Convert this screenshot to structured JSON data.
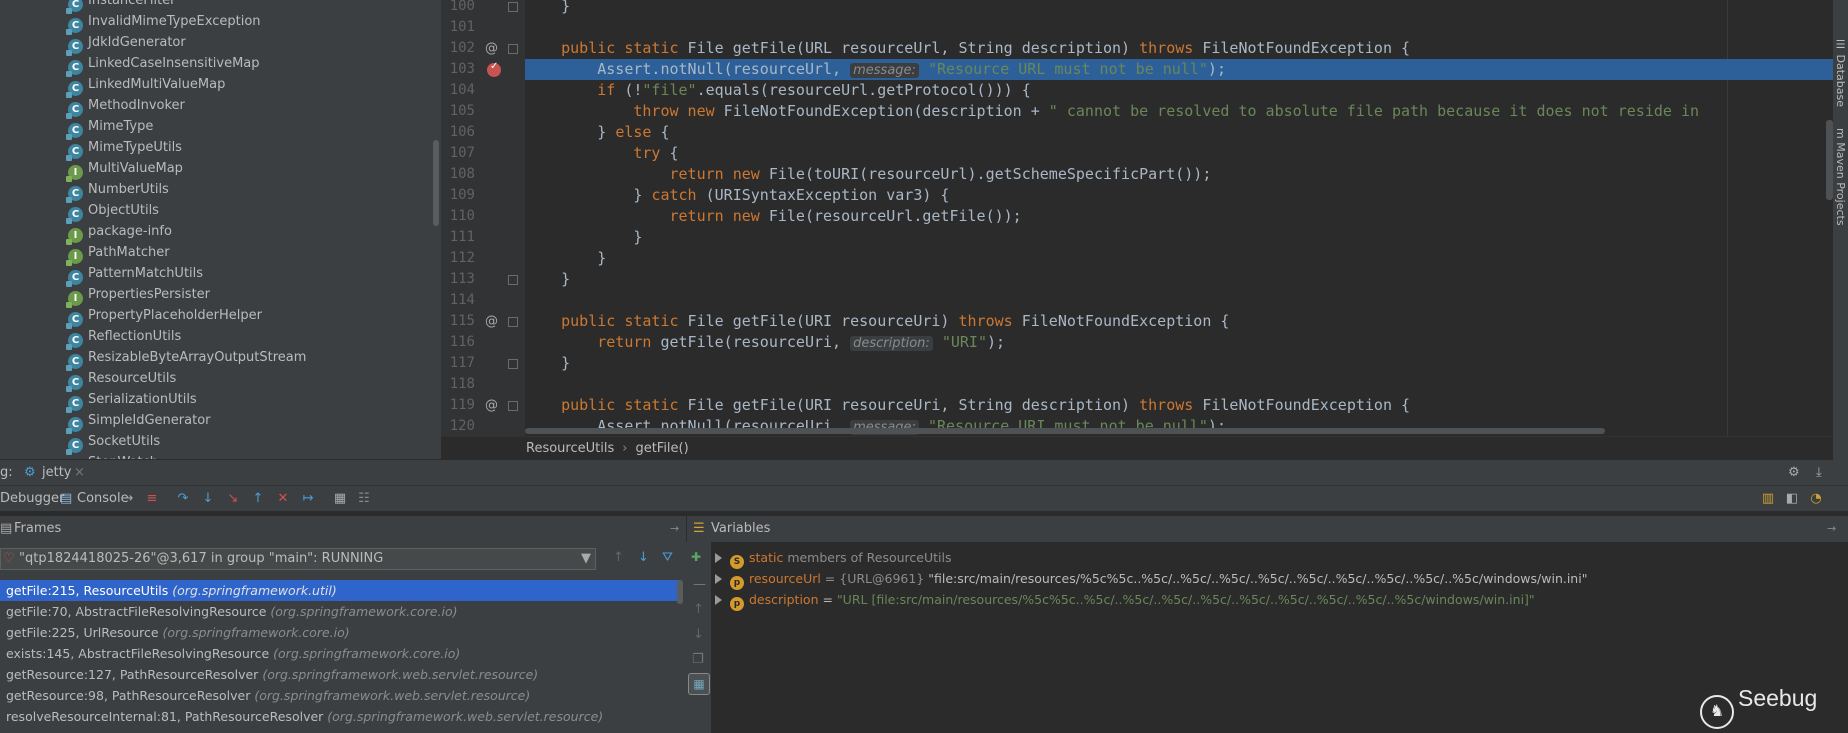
{
  "project_tree": {
    "items": [
      {
        "name": "InstanceFilter",
        "kind": "c"
      },
      {
        "name": "InvalidMimeTypeException",
        "kind": "c"
      },
      {
        "name": "JdkIdGenerator",
        "kind": "c"
      },
      {
        "name": "LinkedCaseInsensitiveMap",
        "kind": "c"
      },
      {
        "name": "LinkedMultiValueMap",
        "kind": "c"
      },
      {
        "name": "MethodInvoker",
        "kind": "c"
      },
      {
        "name": "MimeType",
        "kind": "c"
      },
      {
        "name": "MimeTypeUtils",
        "kind": "c"
      },
      {
        "name": "MultiValueMap",
        "kind": "i"
      },
      {
        "name": "NumberUtils",
        "kind": "c"
      },
      {
        "name": "ObjectUtils",
        "kind": "c"
      },
      {
        "name": "package-info",
        "kind": "i"
      },
      {
        "name": "PathMatcher",
        "kind": "i"
      },
      {
        "name": "PatternMatchUtils",
        "kind": "c"
      },
      {
        "name": "PropertiesPersister",
        "kind": "i"
      },
      {
        "name": "PropertyPlaceholderHelper",
        "kind": "c"
      },
      {
        "name": "ReflectionUtils",
        "kind": "c"
      },
      {
        "name": "ResizableByteArrayOutputStream",
        "kind": "c"
      },
      {
        "name": "ResourceUtils",
        "kind": "c"
      },
      {
        "name": "SerializationUtils",
        "kind": "c"
      },
      {
        "name": "SimpleIdGenerator",
        "kind": "c"
      },
      {
        "name": "SocketUtils",
        "kind": "c"
      },
      {
        "name": "StopWatch",
        "kind": "c"
      }
    ]
  },
  "editor": {
    "lines": [
      {
        "no": "100",
        "html": "    }"
      },
      {
        "no": "101",
        "html": ""
      },
      {
        "no": "102",
        "html": "    <span class=\"kw\">public static</span> File getFile(URL resourceUrl, String description) <span class=\"kw\">throws</span> FileNotFoundException {",
        "mark": "@"
      },
      {
        "no": "103",
        "html": "        Assert.notNull(resourceUrl, <span class=\"hint\">message:</span> <span class=\"str\">\"Resource URL must not be null\"</span>);",
        "hl": true,
        "bp": true
      },
      {
        "no": "104",
        "html": "        <span class=\"kw\">if</span> (!<span class=\"str\">\"file\"</span>.equals(resourceUrl.getProtocol())) {"
      },
      {
        "no": "105",
        "html": "            <span class=\"kw\">throw new</span> FileNotFoundException(description + <span class=\"str\">\" cannot be resolved to absolute file path because it does not reside in</span>"
      },
      {
        "no": "106",
        "html": "        } <span class=\"kw\">else</span> {"
      },
      {
        "no": "107",
        "html": "            <span class=\"kw\">try</span> {"
      },
      {
        "no": "108",
        "html": "                <span class=\"kw\">return new</span> File(toURI(resourceUrl).getSchemeSpecificPart());"
      },
      {
        "no": "109",
        "html": "            } <span class=\"kw\">catch</span> (URISyntaxException var3) {"
      },
      {
        "no": "110",
        "html": "                <span class=\"kw\">return new</span> File(resourceUrl.getFile());"
      },
      {
        "no": "111",
        "html": "            }"
      },
      {
        "no": "112",
        "html": "        }"
      },
      {
        "no": "113",
        "html": "    }"
      },
      {
        "no": "114",
        "html": ""
      },
      {
        "no": "115",
        "html": "    <span class=\"kw\">public static</span> File getFile(URI resourceUri) <span class=\"kw\">throws</span> FileNotFoundException {",
        "mark": "@"
      },
      {
        "no": "116",
        "html": "        <span class=\"kw\">return</span> getFile(resourceUri, <span class=\"hint\">description:</span> <span class=\"str\">\"URI\"</span>);"
      },
      {
        "no": "117",
        "html": "    }"
      },
      {
        "no": "118",
        "html": ""
      },
      {
        "no": "119",
        "html": "    <span class=\"kw\">public static</span> File getFile(URI resourceUri, String description) <span class=\"kw\">throws</span> FileNotFoundException {",
        "mark": "@"
      },
      {
        "no": "120",
        "html": "        Assert.notNull(resourceUri, <span class=\"hint\">message:</span> <span class=\"str\">\"Resource URI must not be null\"</span>);"
      }
    ]
  },
  "breadcrumb": {
    "class_name": "ResourceUtils",
    "method": "getFile()"
  },
  "right_strip": {
    "database": "Database",
    "maven": "Maven Projects"
  },
  "debug": {
    "prefix": "g:",
    "config_name": "jetty",
    "tab_debugger": "Debugger",
    "tab_console": "Console",
    "frames_title": "Frames",
    "variables_title": "Variables",
    "thread": "\"qtp1824418025-26\"@3,617 in group \"main\": RUNNING",
    "frames": [
      {
        "method": "getFile:215, ResourceUtils",
        "pkg": "(org.springframework.util)"
      },
      {
        "method": "getFile:70, AbstractFileResolvingResource",
        "pkg": "(org.springframework.core.io)"
      },
      {
        "method": "getFile:225, UrlResource",
        "pkg": "(org.springframework.core.io)"
      },
      {
        "method": "exists:145, AbstractFileResolvingResource",
        "pkg": "(org.springframework.core.io)"
      },
      {
        "method": "getResource:127, PathResourceResolver",
        "pkg": "(org.springframework.web.servlet.resource)"
      },
      {
        "method": "getResource:98, PathResourceResolver",
        "pkg": "(org.springframework.web.servlet.resource)"
      },
      {
        "method": "resolveResourceInternal:81, PathResourceResolver",
        "pkg": "(org.springframework.web.servlet.resource)"
      }
    ],
    "variables": {
      "static_prefix": "static",
      "static_label": "members of ResourceUtils",
      "v1_name": "resourceUrl",
      "v1_type": " = {URL@6961} ",
      "v1_value": "\"file:src/main/resources/%5c%5c..%5c/..%5c/..%5c/..%5c/..%5c/..%5c/..%5c/..%5c/..%5c/windows/win.ini\"",
      "v2_name": "description",
      "v2_eq": " = ",
      "v2_value": "\"URL [file:src/main/resources/%5c%5c..%5c/..%5c/..%5c/..%5c/..%5c/..%5c/..%5c/..%5c/..%5c/windows/win.ini]\""
    }
  },
  "watermark": "Seebug",
  "colors": {
    "selection": "#2d6099",
    "frame_selected": "#2f65ca",
    "keyword": "#cc7832",
    "string": "#6a8759"
  }
}
